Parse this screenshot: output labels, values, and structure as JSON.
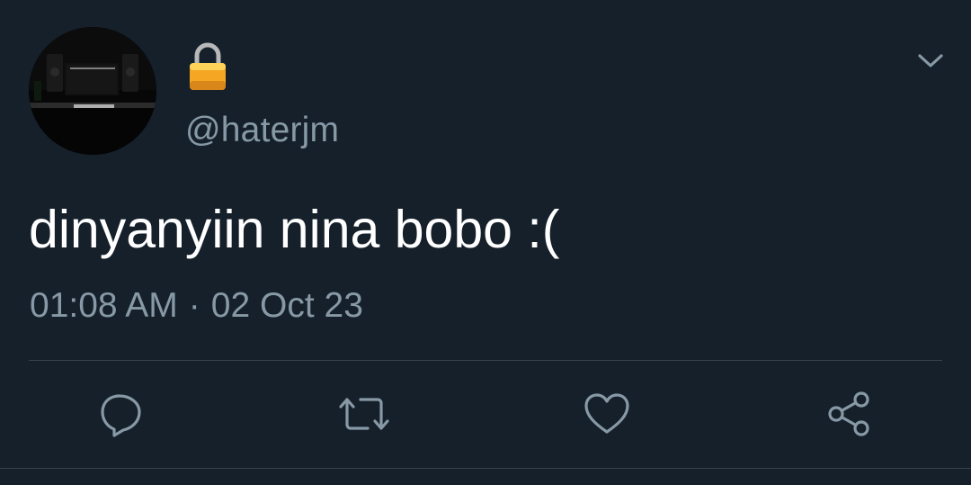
{
  "tweet": {
    "lock_emoji": "🔒",
    "handle": "@haterjm",
    "text": "dinyanyiin nina bobo :(",
    "time": "01:08 AM",
    "separator": "·",
    "date": "02 Oct 23"
  },
  "icons": {
    "more": "chevron-down-icon",
    "reply": "reply-bubble-icon",
    "retweet": "retweet-icon",
    "like": "heart-icon",
    "share": "share-icon",
    "lock": "lock-icon"
  },
  "colors": {
    "background": "#15202b",
    "text_primary": "#ffffff",
    "text_secondary": "#8899a6",
    "divider": "#38444d"
  }
}
